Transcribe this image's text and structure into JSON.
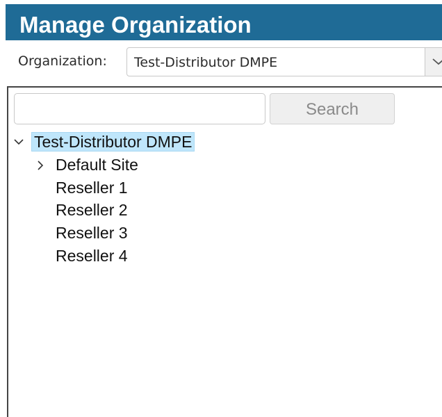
{
  "header": {
    "title": "Manage Organization"
  },
  "organization": {
    "label": "Organization:",
    "selected": "Test-Distributor DMPE"
  },
  "search": {
    "value": "",
    "button_label": "Search"
  },
  "tree": {
    "root": {
      "label": "Test-Distributor DMPE",
      "expanded": true,
      "selected": true
    },
    "children": [
      {
        "label": "Default Site",
        "expandable": true
      },
      {
        "label": "Reseller 1"
      },
      {
        "label": "Reseller 2"
      },
      {
        "label": "Reseller 3"
      },
      {
        "label": "Reseller 4"
      }
    ]
  },
  "colors": {
    "header_bg": "#1f6b96",
    "selection_bg": "#bfe6fb"
  }
}
